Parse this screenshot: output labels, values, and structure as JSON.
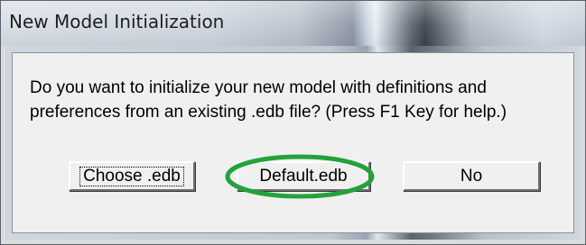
{
  "window": {
    "title": "New Model Initialization"
  },
  "dialog": {
    "message_line1": "Do you want to initialize your new model with definitions and",
    "message_line2": "preferences from an existing .edb file? (Press F1 Key for help.)"
  },
  "buttons": {
    "choose_label": "Choose .edb",
    "default_label": "Default.edb",
    "no_label": "No"
  },
  "annotation": {
    "highlight_color": "#22a33a"
  }
}
